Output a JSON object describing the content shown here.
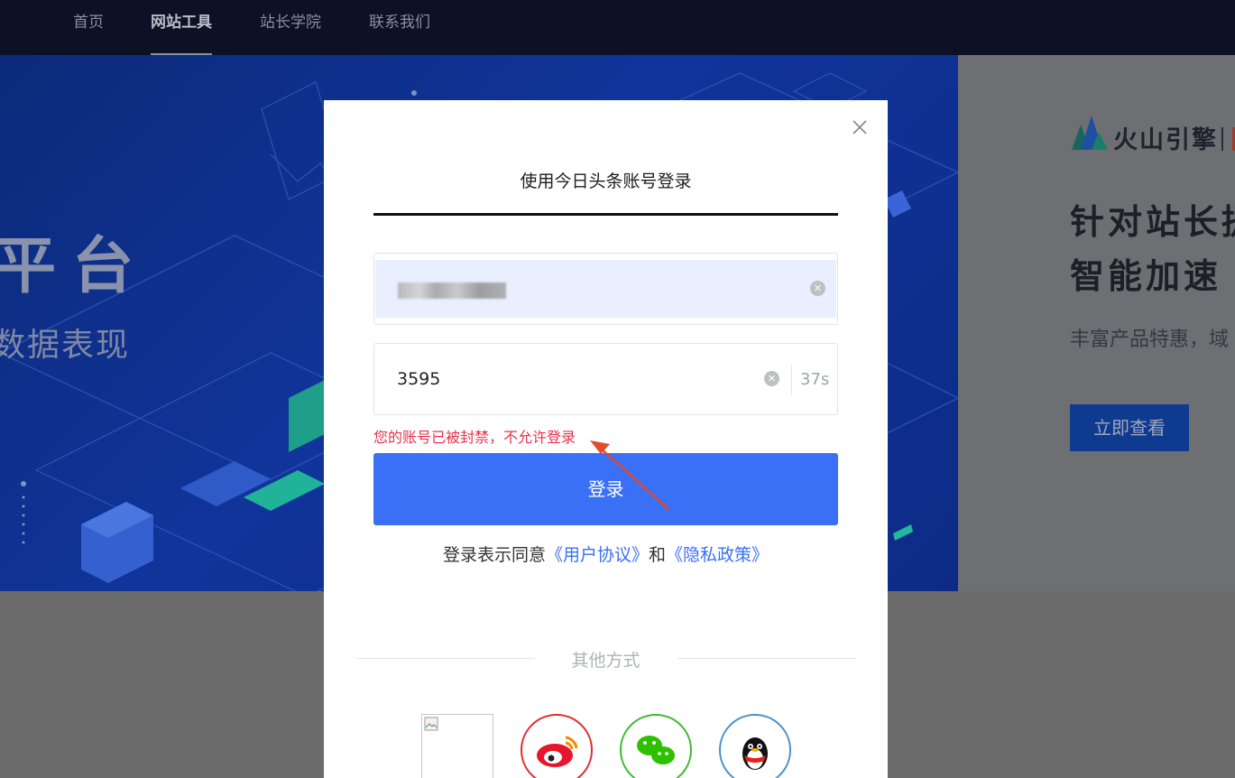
{
  "nav": {
    "items": [
      {
        "label": "首页"
      },
      {
        "label": "网站工具"
      },
      {
        "label": "站长学院"
      },
      {
        "label": "联系我们"
      }
    ],
    "active_index": 1
  },
  "banner": {
    "title": "平台",
    "subtitle": "数据表现"
  },
  "side_ad": {
    "brand": "火山引擎",
    "title_line1": "针对站长提",
    "title_line2": "智能加速",
    "description": "丰富产品特惠，域",
    "button_label": "立即查看"
  },
  "login_modal": {
    "title": "使用今日头条账号登录",
    "phone_value_masked": true,
    "code_value": "3595",
    "countdown": "37s",
    "clear_symbol": "✕",
    "close_symbol": "✕",
    "error_message": "您的账号已被封禁，不允许登录",
    "login_button": "登录",
    "agreement_prefix": "登录表示同意",
    "user_agreement": "《用户协议》",
    "agreement_and": "和",
    "privacy_policy": "《隐私政策》",
    "other_methods": "其他方式",
    "social": [
      {
        "name": "broken-image",
        "icon": "broken-image-icon"
      },
      {
        "name": "weibo",
        "icon": "weibo-icon",
        "color": "#e02c2c"
      },
      {
        "name": "wechat",
        "icon": "wechat-icon",
        "color": "#3cbb2a"
      },
      {
        "name": "qq",
        "icon": "qq-icon",
        "color": "#4a90c8"
      }
    ]
  },
  "colors": {
    "primary": "#3a70f5",
    "error": "#e8324c",
    "nav_bg": "#0c1126",
    "annotation_arrow": "#e24a2a"
  }
}
